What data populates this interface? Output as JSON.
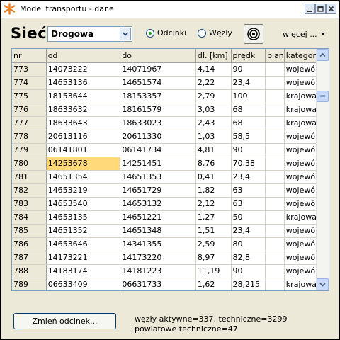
{
  "window": {
    "title": "Model transportu - dane"
  },
  "toolbar": {
    "network_label": "Sieć",
    "network_type_selected": "Drogowa",
    "radio_sections_label": "Odcinki",
    "radio_sections_selected": true,
    "radio_nodes_label": "Węzły",
    "radio_nodes_selected": false,
    "more_label": "więcej ..."
  },
  "table": {
    "columns": [
      "nr",
      "od",
      "do",
      "dł. [km]",
      "prędk",
      "plan",
      "kategor"
    ],
    "rows": [
      [
        "773",
        "14073222",
        "14071967",
        "4,14",
        "90",
        "",
        "wojewó"
      ],
      [
        "774",
        "14653136",
        "14651574",
        "2,22",
        "23,4",
        "",
        "wojewó"
      ],
      [
        "775",
        "18153644",
        "18153357",
        "2,79",
        "100",
        "",
        "krajowa"
      ],
      [
        "776",
        "18633632",
        "18161579",
        "3,03",
        "68",
        "",
        "krajowa"
      ],
      [
        "777",
        "18633643",
        "18633023",
        "2,43",
        "68",
        "",
        "krajowa"
      ],
      [
        "778",
        "20613116",
        "20611330",
        "1,03",
        "58,5",
        "",
        "wojewó"
      ],
      [
        "779",
        "06141801",
        "06141734",
        "4,81",
        "90",
        "",
        "wojewó"
      ],
      [
        "780",
        "14253678",
        "14251451",
        "8,76",
        "70,38",
        "",
        "wojewó"
      ],
      [
        "781",
        "14651354",
        "14651353",
        "0,41",
        "23,4",
        "",
        "wojewó"
      ],
      [
        "782",
        "14653219",
        "14651729",
        "1,82",
        "63",
        "",
        "wojewó"
      ],
      [
        "783",
        "14653540",
        "14653132",
        "2,12",
        "63",
        "",
        "wojewó"
      ],
      [
        "784",
        "14653135",
        "14651221",
        "1,27",
        "50",
        "",
        "krajowa"
      ],
      [
        "785",
        "14651352",
        "14651348",
        "1,51",
        "23,4",
        "",
        "wojewó"
      ],
      [
        "786",
        "14653646",
        "14341355",
        "2,59",
        "80",
        "",
        "wojewó"
      ],
      [
        "787",
        "14173221",
        "14173220",
        "8,97",
        "82,8",
        "",
        "wojewó"
      ],
      [
        "788",
        "14183174",
        "14181223",
        "11,19",
        "90",
        "",
        "wojewó"
      ],
      [
        "789",
        "06633409",
        "06631733",
        "1,62",
        "28,215",
        "",
        "krajowa"
      ]
    ],
    "selected_cell": {
      "row": 7,
      "col": 1
    }
  },
  "footer": {
    "change_button_label": "Zmień odcinek...",
    "status_line1": "węzły aktywne=337, techniczne=3299",
    "status_line2": "powiatowe techniczne=47"
  },
  "colors": {
    "selected_cell": "#ffd97a",
    "radio_dot": "#21a121",
    "app_icon": "#f07a1a"
  }
}
